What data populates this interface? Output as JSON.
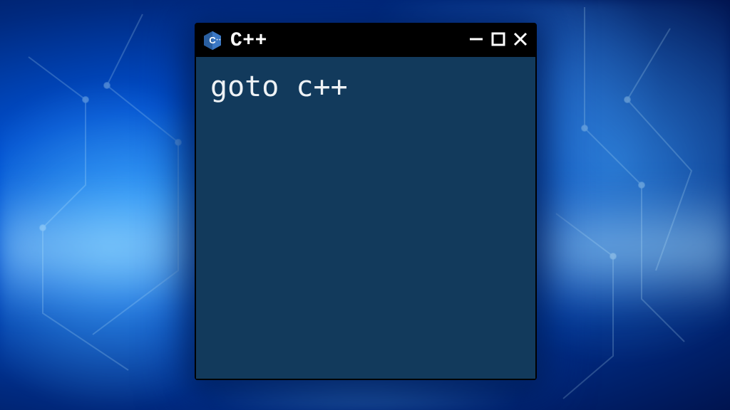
{
  "window": {
    "title": "C++",
    "icon_name": "cpp-logo-icon"
  },
  "editor": {
    "content": "goto c++"
  },
  "colors": {
    "titlebar_bg": "#000000",
    "content_bg": "#123a5c",
    "text": "#eef2f5"
  }
}
